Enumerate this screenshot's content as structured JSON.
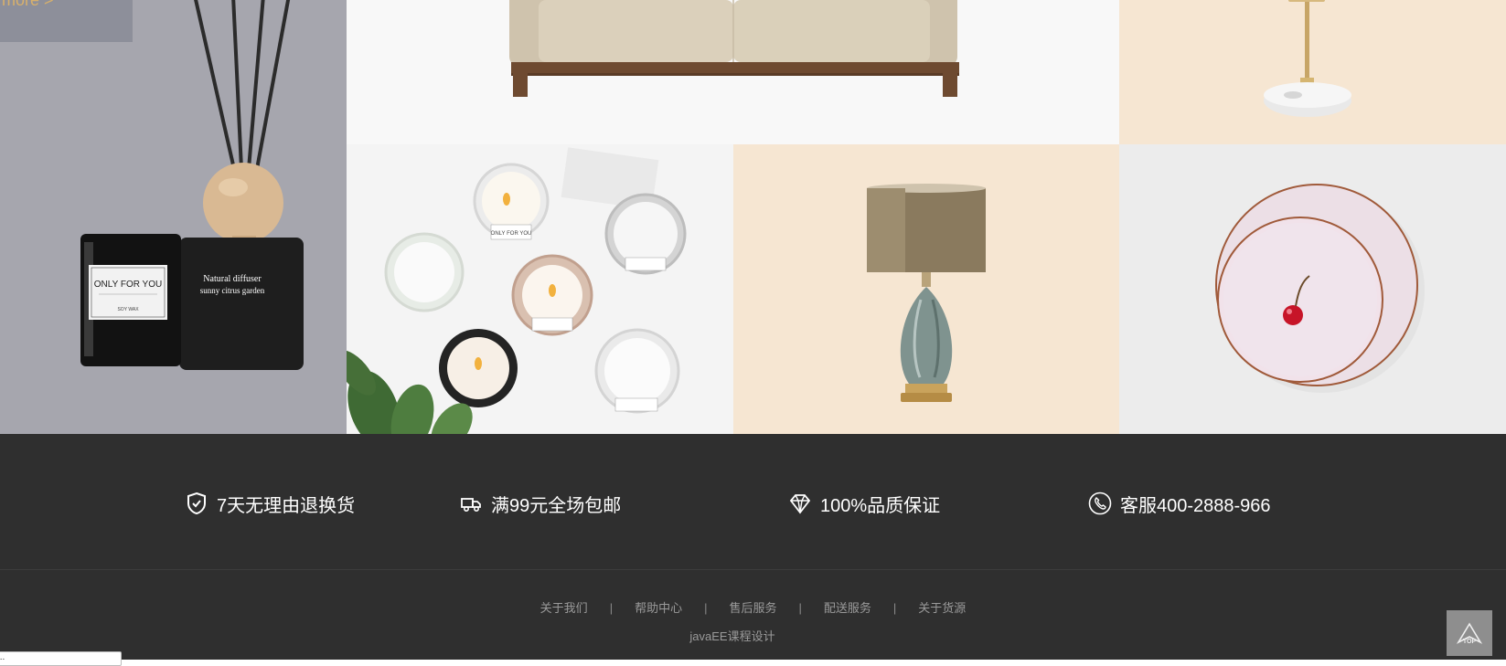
{
  "gallery": {
    "more_link": "more >",
    "tiles": [
      {
        "id": "diffuser",
        "labels": [
          "ONLY FOR YOU",
          "SOY WAX",
          "Natural diffuser",
          "sunny citrus garden"
        ]
      },
      {
        "id": "sofa"
      },
      {
        "id": "stand"
      },
      {
        "id": "candles",
        "labels": [
          "ONLY FOR YOU"
        ]
      },
      {
        "id": "lamp"
      },
      {
        "id": "plates"
      }
    ]
  },
  "services": [
    {
      "icon": "shield-check-icon",
      "label": "7天无理由退换货"
    },
    {
      "icon": "truck-icon",
      "label": "满99元全场包邮"
    },
    {
      "icon": "diamond-icon",
      "label": "100%品质保证"
    },
    {
      "icon": "phone-icon",
      "label": "客服400-2888-966"
    }
  ],
  "footer_links": [
    "关于我们",
    "帮助中心",
    "售后服务",
    "配送服务",
    "关于货源"
  ],
  "footer_separator": "|",
  "copyright": "javaEE课程设计",
  "status_tip": "...",
  "top_button": {
    "label": "TOP"
  },
  "colors": {
    "footer_bg": "#2f2f2f",
    "accent_gold": "#d8b06b"
  }
}
